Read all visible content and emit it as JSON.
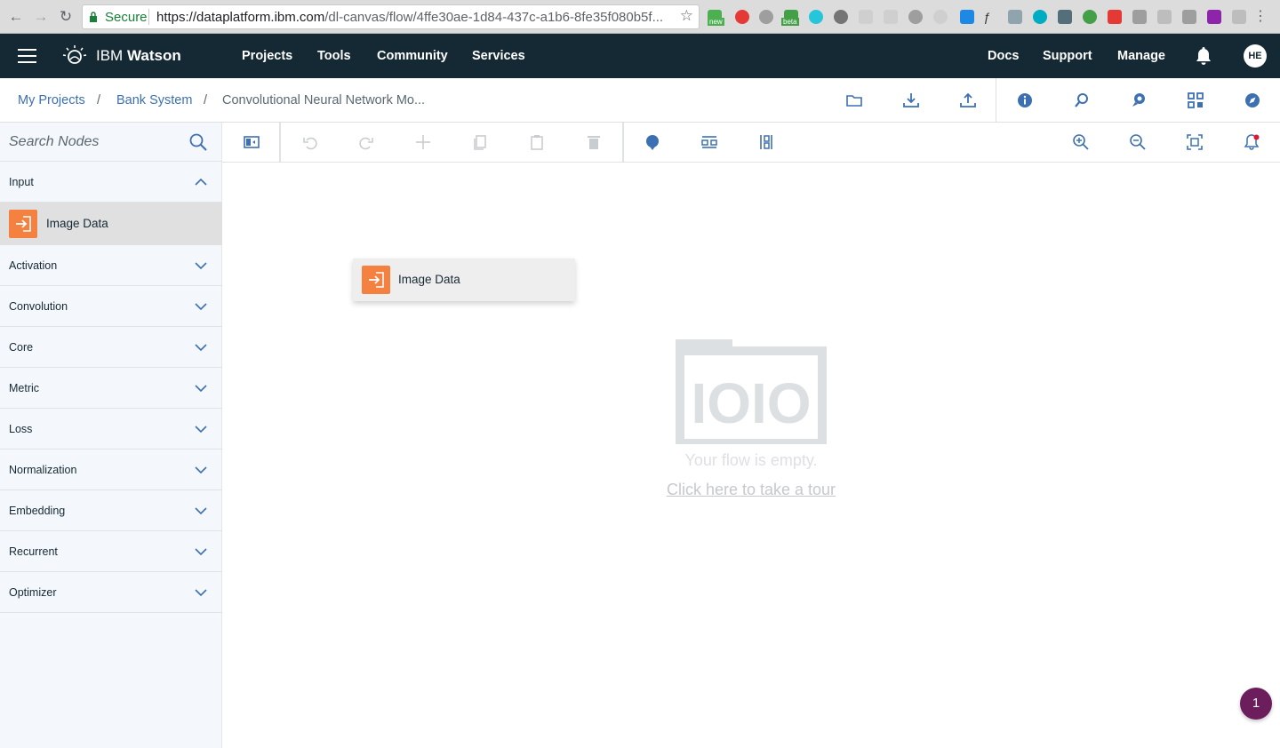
{
  "browser": {
    "secure_label": "Secure",
    "url_host": "https://dataplatform.ibm.com",
    "url_path": "/dl-canvas/flow/4ffe30ae-1d84-437c-a1b6-8fe35f080b5f...",
    "extension_badges": [
      "new",
      "beta"
    ]
  },
  "topnav": {
    "brand_prefix": "IBM",
    "brand_name": "Watson",
    "links": [
      "Projects",
      "Tools",
      "Community",
      "Services"
    ],
    "right_links": [
      "Docs",
      "Support",
      "Manage"
    ],
    "avatar_initials": "HE",
    "bg_color": "#152935"
  },
  "breadcrumb": {
    "items": [
      "My Projects",
      "Bank System"
    ],
    "separator": "/",
    "current": "Convolutional Neural Network Mo..."
  },
  "sidebar": {
    "search_placeholder": "Search Nodes",
    "categories": [
      {
        "label": "Input",
        "expanded": true
      },
      {
        "label": "Activation",
        "expanded": false
      },
      {
        "label": "Convolution",
        "expanded": false
      },
      {
        "label": "Core",
        "expanded": false
      },
      {
        "label": "Metric",
        "expanded": false
      },
      {
        "label": "Loss",
        "expanded": false
      },
      {
        "label": "Normalization",
        "expanded": false
      },
      {
        "label": "Embedding",
        "expanded": false
      },
      {
        "label": "Recurrent",
        "expanded": false
      },
      {
        "label": "Optimizer",
        "expanded": false
      }
    ],
    "input_nodes": [
      "Image Data"
    ]
  },
  "canvas": {
    "dragged_node_label": "Image Data",
    "empty_message": "Your flow is empty.",
    "tour_link": "Click here to take a tour",
    "illustration_text": "IOIO"
  },
  "notifications": {
    "count": "1"
  },
  "colors": {
    "accent": "#3d70b2",
    "node_orange": "#f4813f",
    "badge": "#6b1d5c"
  }
}
